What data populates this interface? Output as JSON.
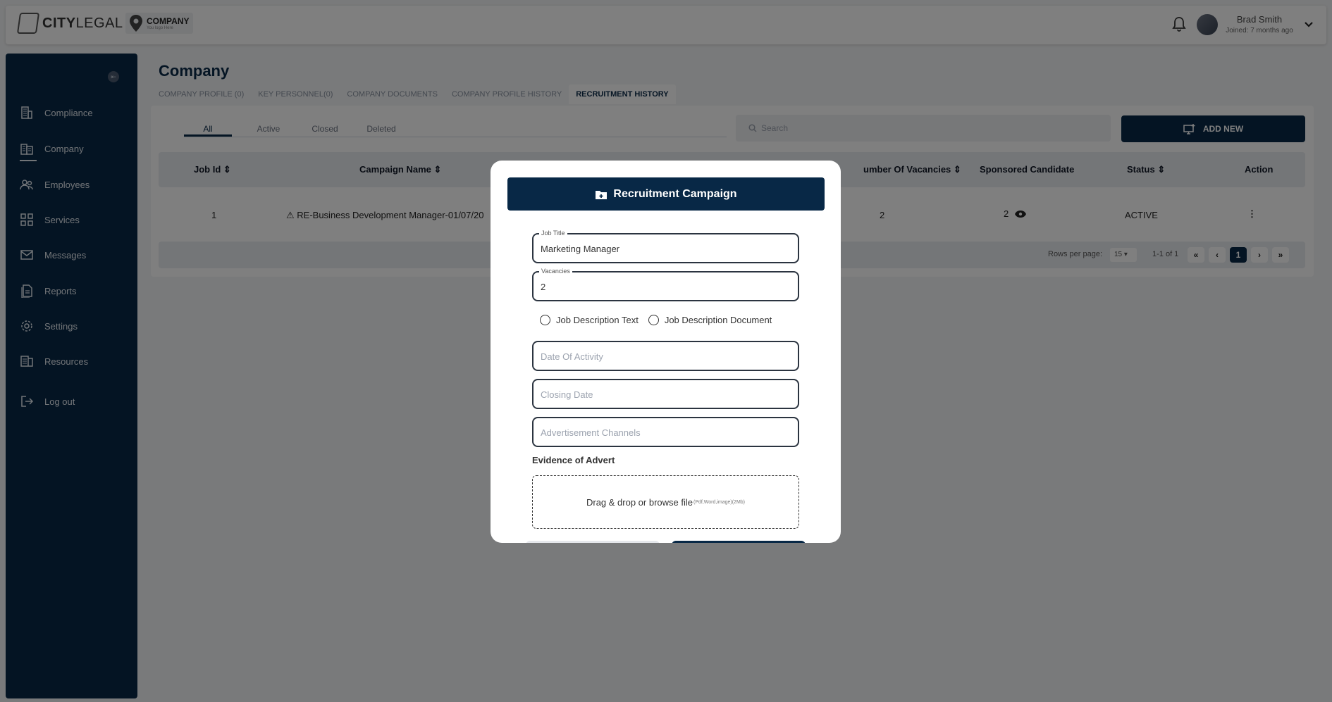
{
  "brand": {
    "logo_text_bold": "CITY",
    "logo_text_light": "LEGAL",
    "company_name": "COMPANY",
    "company_tagline": "You logo Here"
  },
  "user": {
    "name": "Brad Smith",
    "joined": "Joined: 7 months ago"
  },
  "sidebar": {
    "items": [
      {
        "label": "Compliance",
        "icon": "building-icon"
      },
      {
        "label": "Company",
        "icon": "company-icon"
      },
      {
        "label": "Employees",
        "icon": "users-icon"
      },
      {
        "label": "Services",
        "icon": "grid-icon"
      },
      {
        "label": "Messages",
        "icon": "mail-icon"
      },
      {
        "label": "Reports",
        "icon": "report-icon"
      },
      {
        "label": "Settings",
        "icon": "gear-icon"
      },
      {
        "label": "Resources",
        "icon": "resources-icon"
      },
      {
        "label": "Log out",
        "icon": "logout-icon"
      }
    ]
  },
  "page": {
    "title": "Company"
  },
  "tabs": [
    "COMPANY PROFILE (0)",
    "KEY PERSONNEL(0)",
    "COMPANY DOCUMENTS",
    "COMPANY PROFILE HISTORY",
    "RECRUITMENT HISTORY"
  ],
  "subtabs": [
    "All",
    "Active",
    "Closed",
    "Deleted"
  ],
  "search": {
    "placeholder": "Search"
  },
  "add_new_label": "ADD NEW",
  "table": {
    "headers": {
      "job_id": "Job Id",
      "campaign": "Campaign Name",
      "vacancies": "umber Of Vacancies",
      "sponsored": "Sponsored Candidate",
      "status": "Status",
      "action": "Action"
    },
    "rows": [
      {
        "job_id": "1",
        "campaign": "⚠ RE-Business Development Manager-01/07/20",
        "vacancies": "2",
        "sponsored": "2",
        "status": "ACTIVE"
      }
    ],
    "footer": {
      "rows_per_page_label": "Rows per page:",
      "rows_per_page": "15",
      "range": "1-1 of 1",
      "current_page": "1"
    }
  },
  "modal": {
    "title": "Recruitment Campaign",
    "job_title": {
      "label": "Job Title",
      "value": "Marketing Manager"
    },
    "vacancies": {
      "label": "Vacancies",
      "value": "2"
    },
    "radio_text": "Job Description Text",
    "radio_doc": "Job Description Document",
    "date_activity": "Date Of Activity",
    "closing_date": "Closing Date",
    "ad_channels": "Advertisement Channels",
    "evidence_label": "Evidence of Advert",
    "drop_text": "Drag & drop or browse file",
    "drop_hint": "(Pdf,Word,image)(2Mb)"
  }
}
